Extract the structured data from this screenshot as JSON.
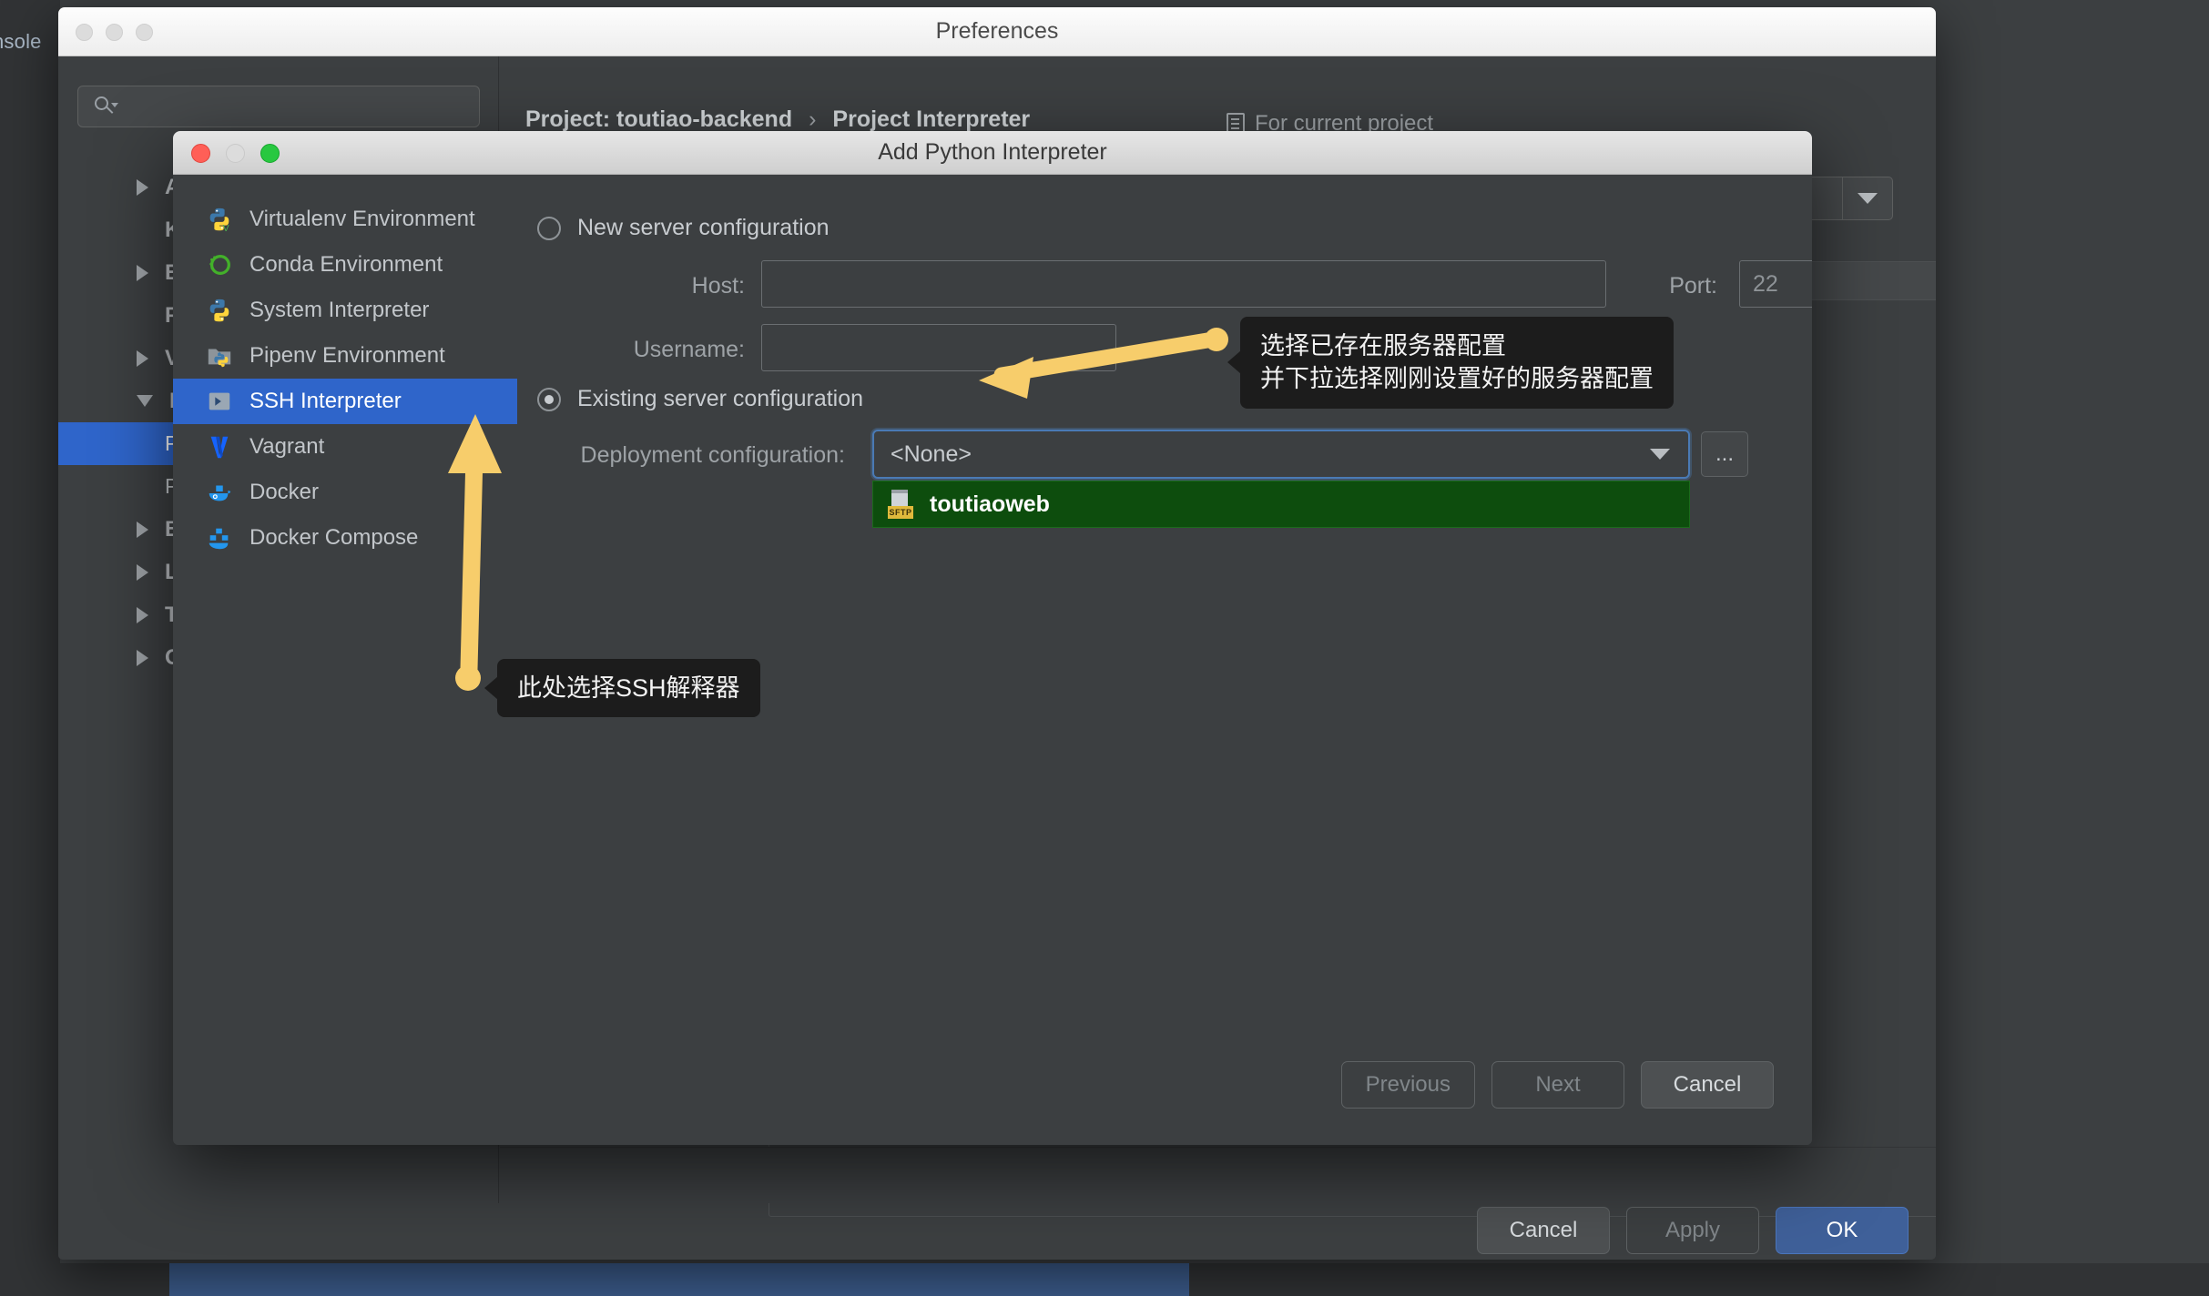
{
  "background": {
    "console_label": "nsole"
  },
  "preferences": {
    "title": "Preferences",
    "search": {
      "value": "",
      "placeholder": ""
    },
    "tree": [
      {
        "label": "Appearance & Behavior",
        "state": "collapsed",
        "level": 0,
        "selected": false
      },
      {
        "label": "Keymap",
        "state": "none",
        "level": 0,
        "selected": false
      },
      {
        "label": "Editor",
        "state": "collapsed",
        "level": 0,
        "selected": false
      },
      {
        "label": "Plugins",
        "state": "none",
        "level": 0,
        "selected": false
      },
      {
        "label": "Version Control",
        "state": "collapsed",
        "level": 0,
        "selected": false
      },
      {
        "label": "Project: toutiao-backend",
        "state": "expanded",
        "level": 0,
        "selected": false
      },
      {
        "label": "Project Interpreter",
        "state": "none",
        "level": 1,
        "selected": true
      },
      {
        "label": "Project Structure",
        "state": "none",
        "level": 1,
        "selected": false
      },
      {
        "label": "Build, Execution, Deployment",
        "state": "collapsed",
        "level": 0,
        "selected": false
      },
      {
        "label": "Languages & Frameworks",
        "state": "collapsed",
        "level": 0,
        "selected": false
      },
      {
        "label": "Tools",
        "state": "collapsed",
        "level": 0,
        "selected": false
      },
      {
        "label": "Other Settings",
        "state": "collapsed",
        "level": 0,
        "selected": false
      }
    ],
    "breadcrumb": {
      "project": "Project: toutiao-backend",
      "separator": "›",
      "page": "Project Interpreter"
    },
    "for_current_project": "For current project",
    "interpreter_combo_value": "",
    "footer": {
      "help": "?",
      "cancel": "Cancel",
      "apply": "Apply",
      "ok": "OK"
    }
  },
  "dialog": {
    "title": "Add Python Interpreter",
    "types": [
      {
        "label": "Virtualenv Environment",
        "icon": "python-venv-icon",
        "selected": false
      },
      {
        "label": "Conda Environment",
        "icon": "conda-icon",
        "selected": false
      },
      {
        "label": "System Interpreter",
        "icon": "python-icon",
        "selected": false
      },
      {
        "label": "Pipenv Environment",
        "icon": "pipenv-icon",
        "selected": false
      },
      {
        "label": "SSH Interpreter",
        "icon": "ssh-icon",
        "selected": true
      },
      {
        "label": "Vagrant",
        "icon": "vagrant-icon",
        "selected": false
      },
      {
        "label": "Docker",
        "icon": "docker-icon",
        "selected": false
      },
      {
        "label": "Docker Compose",
        "icon": "docker-compose-icon",
        "selected": false
      }
    ],
    "new_server": {
      "radio_label": "New server configuration",
      "selected": false,
      "host_label": "Host:",
      "host_value": "",
      "port_label": "Port:",
      "port_value": "22",
      "username_label": "Username:",
      "username_value": ""
    },
    "existing_server": {
      "radio_label": "Existing server configuration",
      "selected": true,
      "deployment_label": "Deployment configuration:",
      "deployment_value": "<None>",
      "browse_label": "...",
      "dropdown_options": [
        {
          "label": "toutiaoweb",
          "icon": "sftp-server-icon",
          "badge": "SFTP",
          "highlighted": true
        }
      ]
    },
    "buttons": {
      "previous": "Previous",
      "next": "Next",
      "cancel": "Cancel"
    }
  },
  "annotations": [
    {
      "id": "tip-existing-server",
      "text": "选择已存在服务器配置\n并下拉选择刚刚设置好的服务器配置"
    },
    {
      "id": "tip-ssh-interpreter",
      "text": "此处选择SSH解释器"
    }
  ],
  "colors": {
    "accent_blue": "#2f65ca",
    "annotation_yellow": "#f7cd6b",
    "dropdown_green": "#0d4d0d",
    "window_bg": "#3c3f41"
  }
}
